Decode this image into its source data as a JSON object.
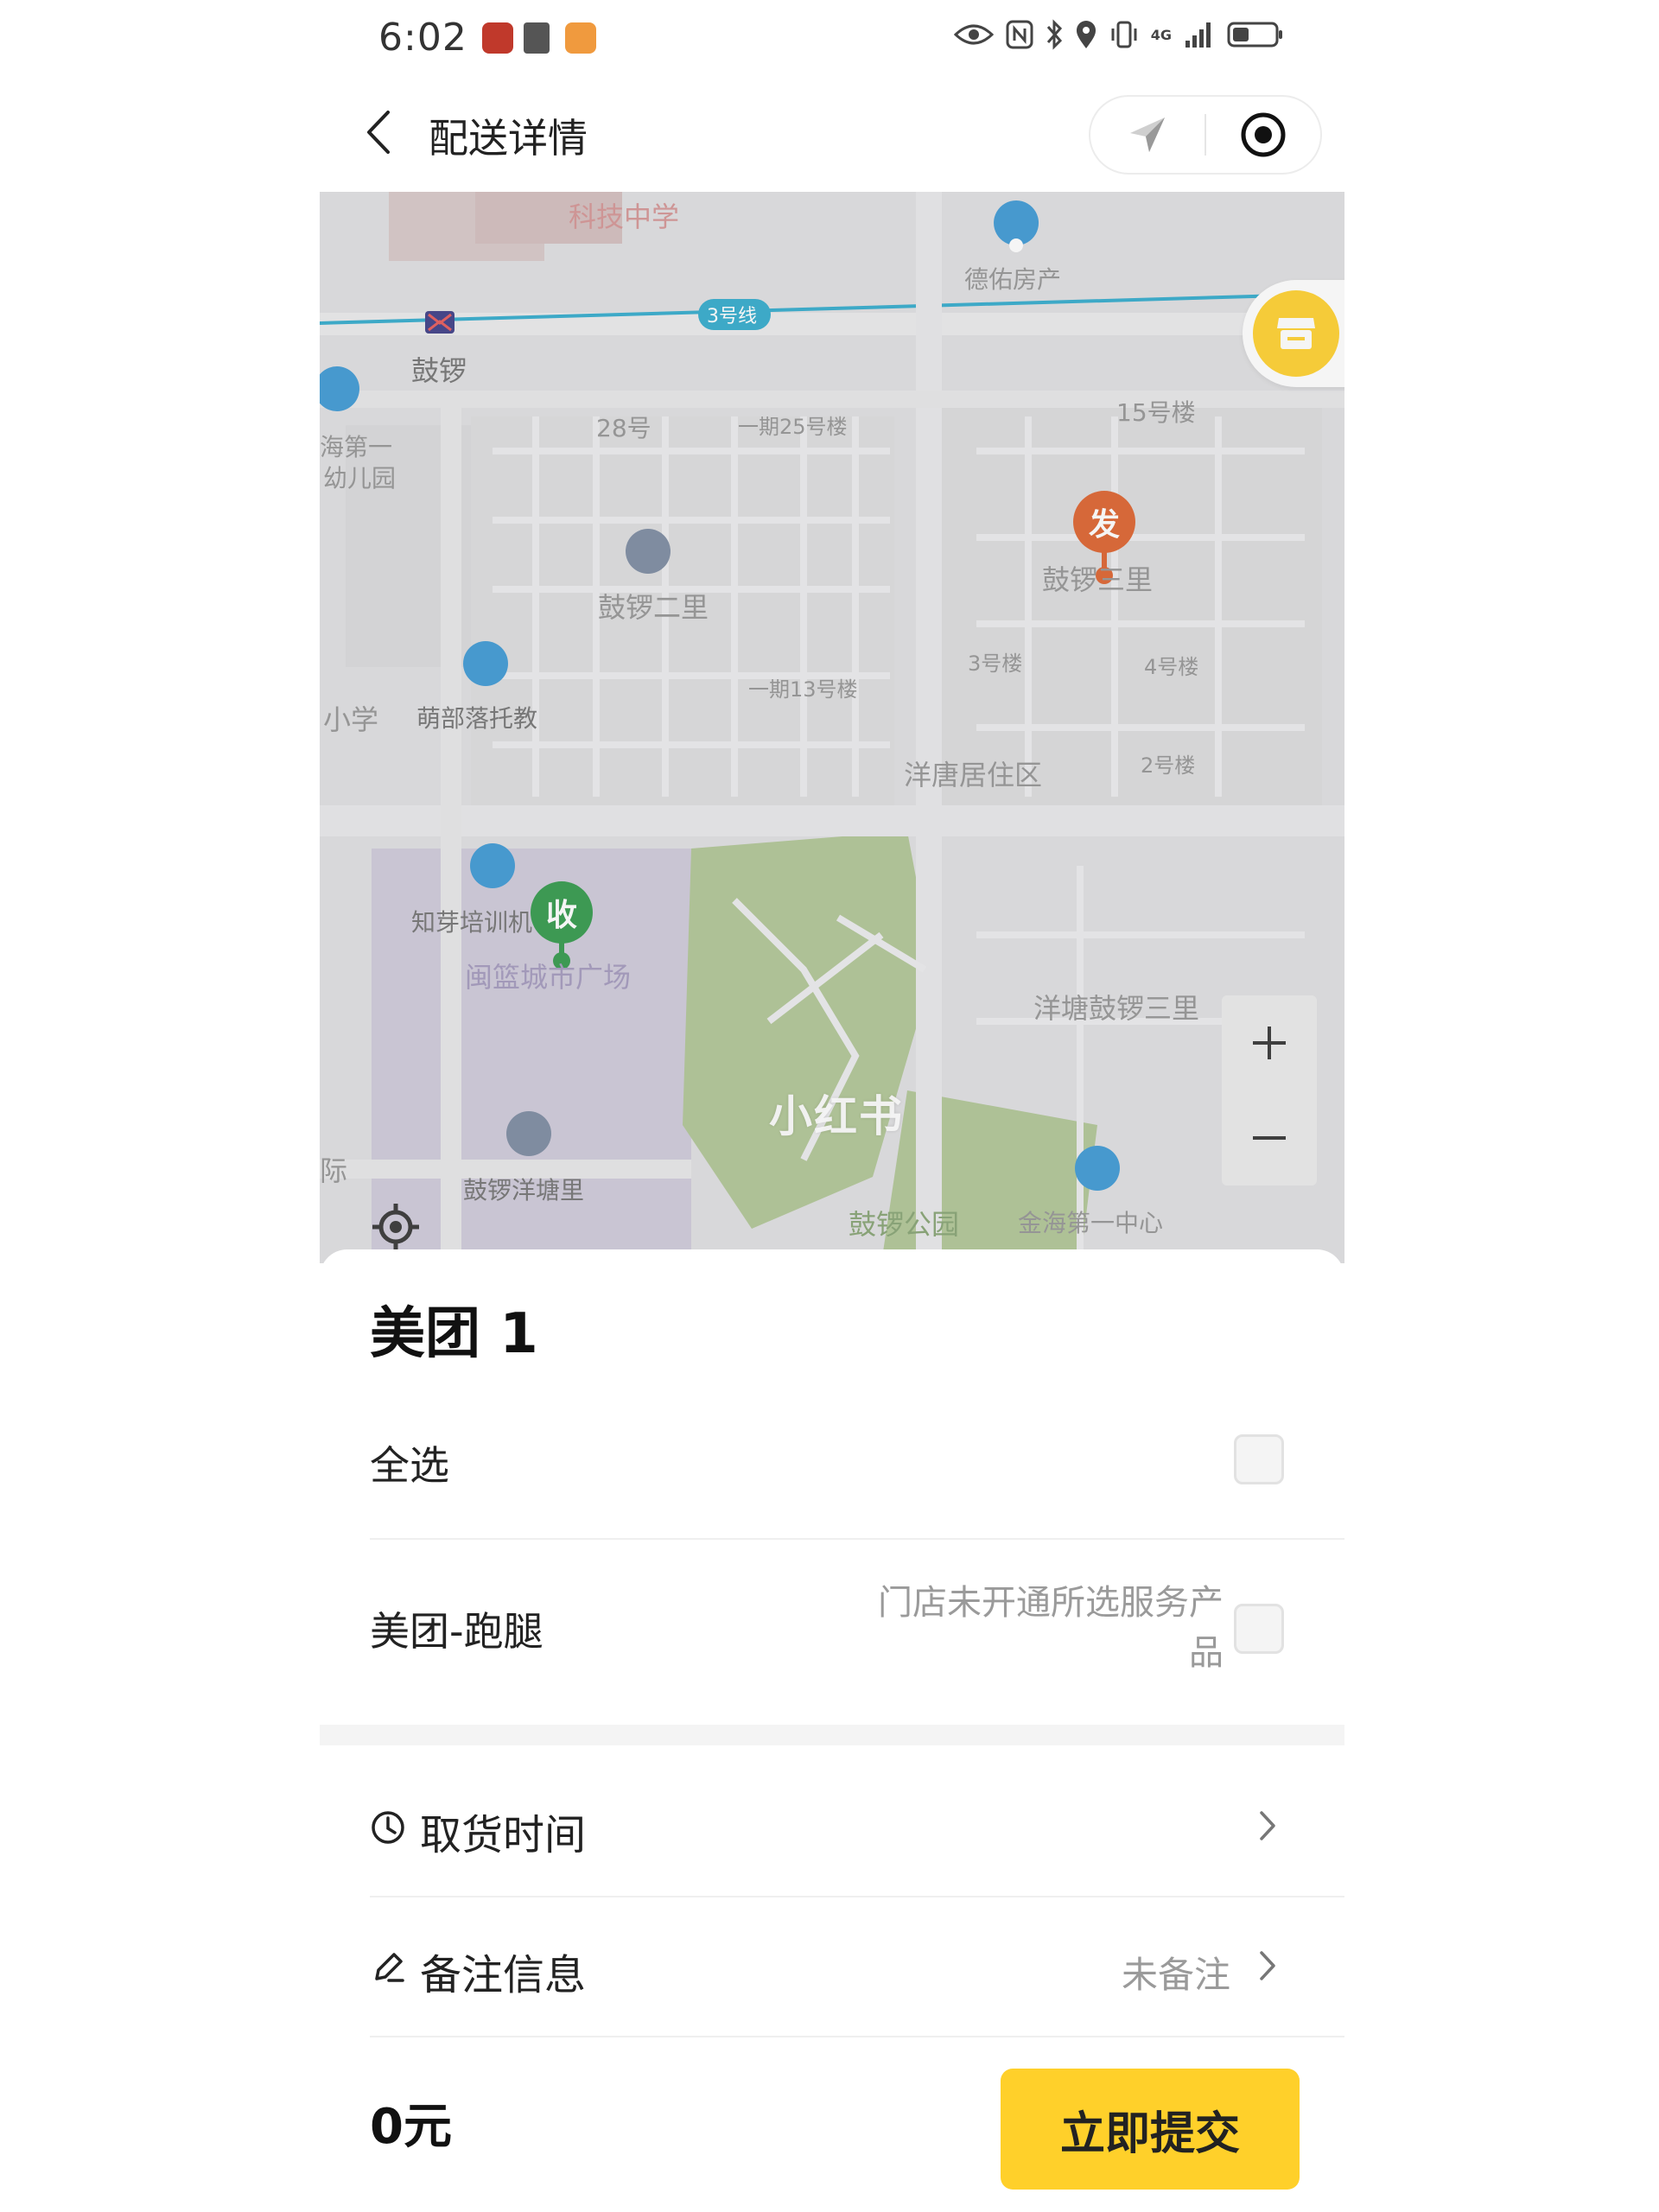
{
  "status_bar": {
    "time": "6:02",
    "network": "4G"
  },
  "nav": {
    "title": "配送详情"
  },
  "map": {
    "labels": {
      "school": "科技中学",
      "realty": "德佑房产",
      "metro_line": "3号线",
      "station": "鼓锣",
      "kindergarten_a": "海第一",
      "kindergarten_b": "幼儿园",
      "b28": "28号",
      "b25": "一期25号楼",
      "b15": "15号楼",
      "guluo2": "鼓锣二里",
      "guluo3": "鼓锣三里",
      "b3": "3号楼",
      "b4": "4号楼",
      "b13": "一期13号楼",
      "primary": "小学",
      "daycare": "萌部落托教",
      "yangtang_res": "洋唐居住区",
      "b2": "2号楼",
      "training": "知芽培训机",
      "mall": "闽篮城市广场",
      "yangtang_guluo": "洋塘鼓锣三里",
      "edge": "际",
      "guluo_yangtang": "鼓锣洋塘里",
      "park": "鼓锣公园",
      "jinhai": "金海第一中心"
    },
    "pin_send": "发",
    "pin_receive": "收",
    "watermark": "小红书",
    "colors": {
      "send_pin": "#d9541a",
      "receive_pin": "#1f8f3a",
      "poi_blue": "#2b8fd0",
      "metro": "#1fa3c7",
      "park": "#9ec77c"
    }
  },
  "sheet": {
    "company": "美团 1",
    "select_all_label": "全选",
    "service_label": "美团-跑腿",
    "service_unavailable": "门店未开通所选服务产品",
    "pickup_time_label": "取货时间",
    "remark_label": "备注信息",
    "remark_value": "未备注",
    "price": "0元",
    "submit_label": "立即提交",
    "accent": "#ffd02a"
  }
}
